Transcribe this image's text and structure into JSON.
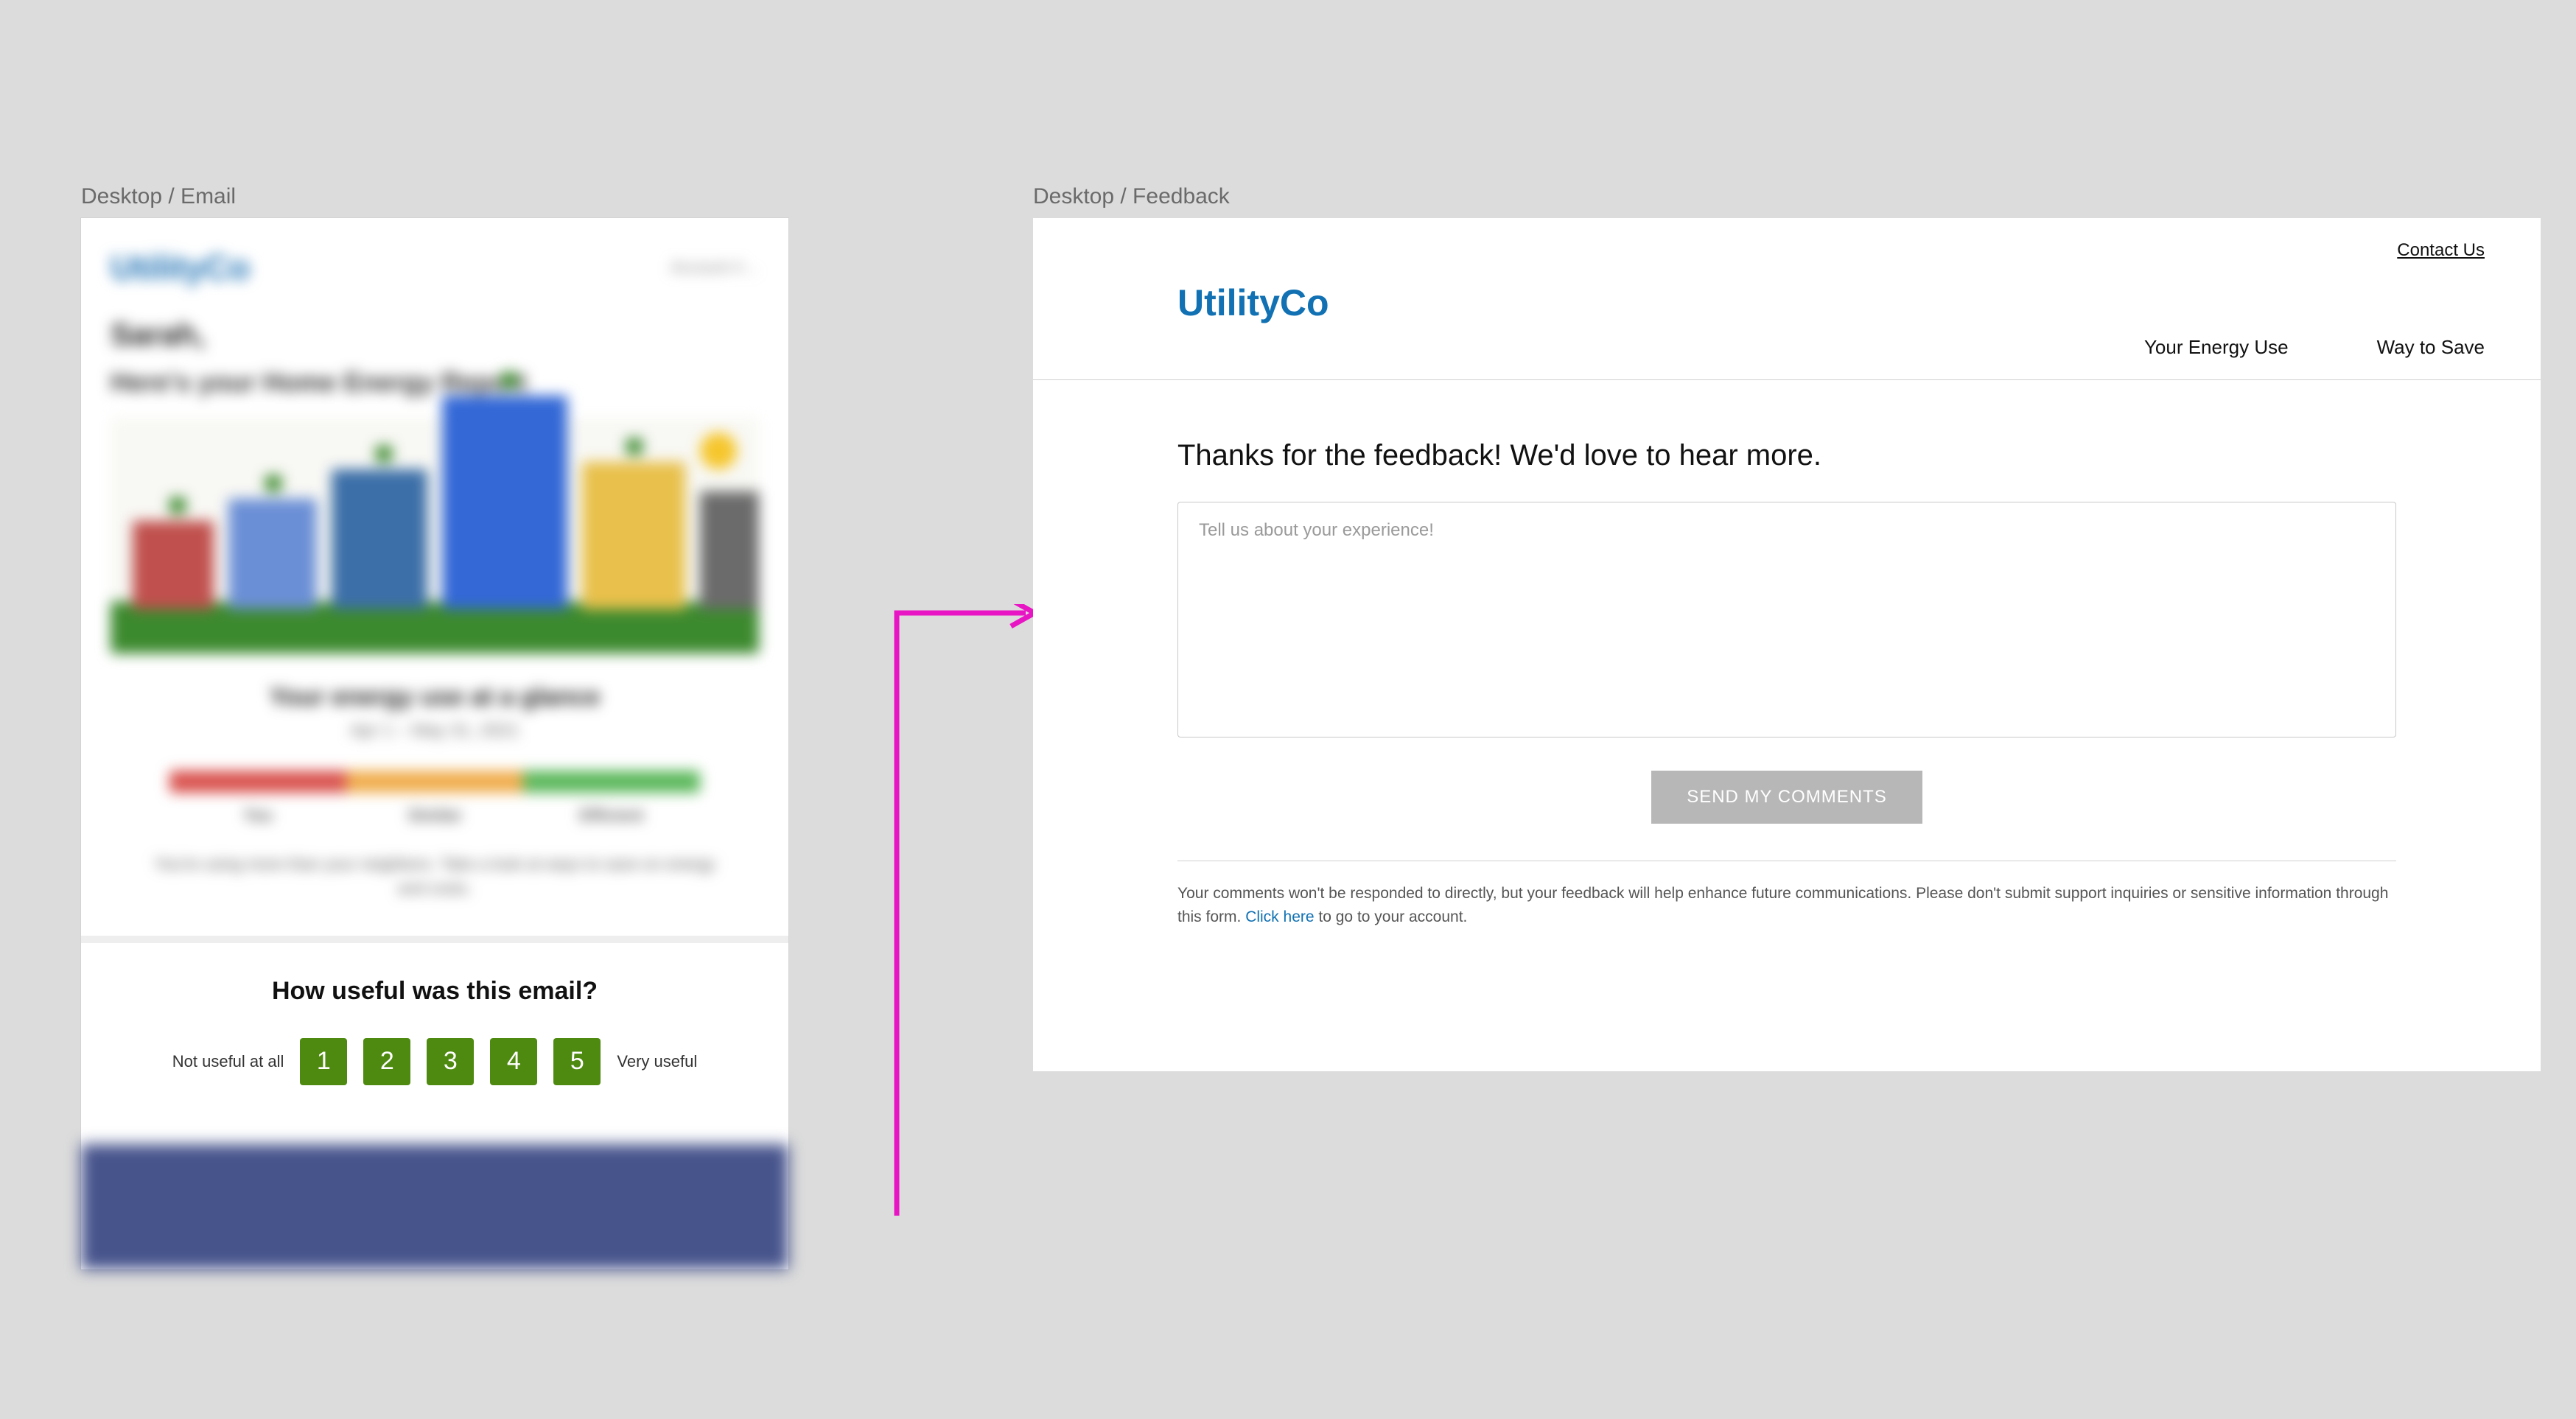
{
  "labels": {
    "email_panel": "Desktop / Email",
    "feedback_panel": "Desktop / Feedback"
  },
  "email": {
    "logo": "UtilityCo",
    "account": "Account #…",
    "greeting": "Sarah,",
    "subheading": "Here's your Home\nEnergy Report",
    "glance_title": "Your energy use at a glance",
    "glance_period": "Apr 1 – May 31, 2021",
    "meter_labels": {
      "low": "You",
      "mid": "Similar",
      "high": "Efficient"
    },
    "glance_note": "You're using more than your neighbors. Take a look at ways to save on energy and costs.",
    "rating": {
      "title": "How useful was this email?",
      "low_label": "Not useful at all",
      "high_label": "Very useful",
      "options": [
        "1",
        "2",
        "3",
        "4",
        "5"
      ]
    }
  },
  "feedback": {
    "logo": "UtilityCo",
    "contact_label": "Contact Us",
    "nav": {
      "energy_use": "Your Energy Use",
      "way_to_save": "Way to Save"
    },
    "heading": "Thanks for the feedback! We'd love to hear more.",
    "textarea_placeholder": "Tell us about your experience!",
    "submit_label": "SEND MY COMMENTS",
    "disclaimer_pre": "Your comments won't be responded to directly, but your feedback will help enhance future communications. Please don't submit support inquiries or sensitive information through this form. ",
    "disclaimer_link": "Click here",
    "disclaimer_post": " to go to your account."
  },
  "colors": {
    "brand": "#1171b3",
    "rating_btn": "#4f8a10",
    "arrow": "#e815c4"
  }
}
